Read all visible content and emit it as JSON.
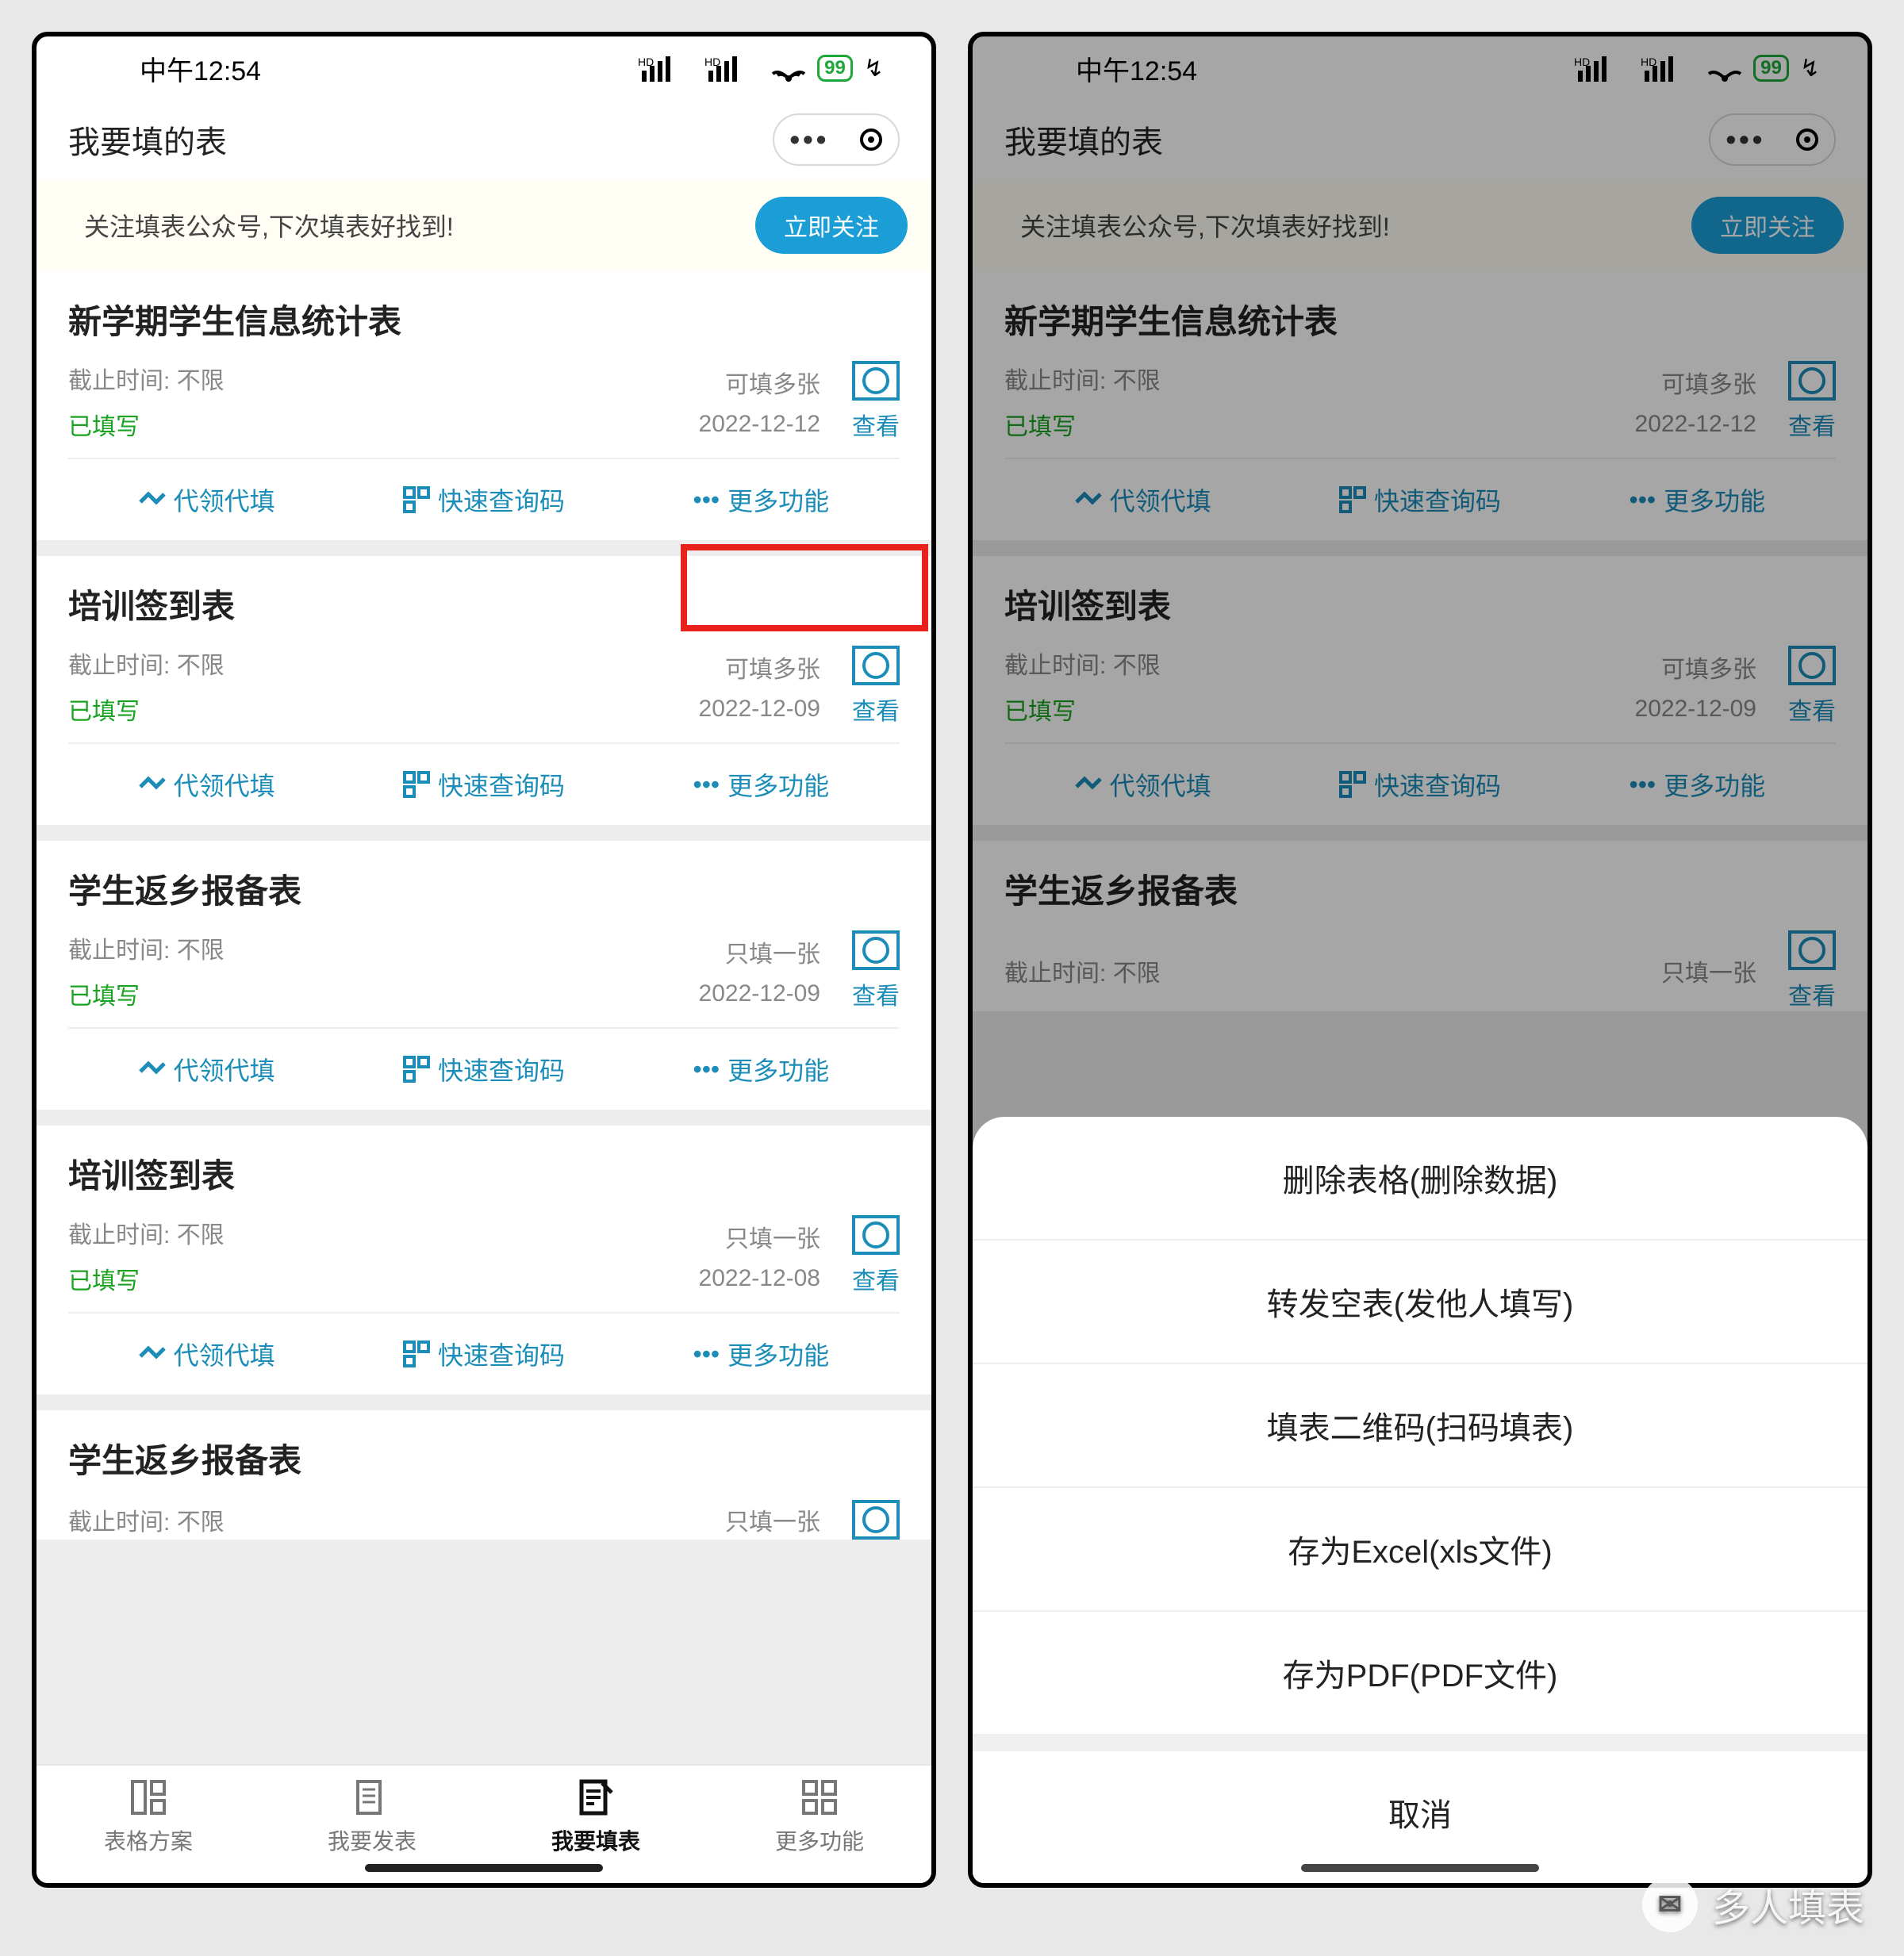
{
  "status": {
    "time": "中午12:54",
    "battery": "99"
  },
  "header": {
    "title": "我要填的表",
    "menu_dots": "•••"
  },
  "banner": {
    "text": "关注填表公众号,下次填表好找到!",
    "button": "立即关注"
  },
  "common": {
    "deadline_prefix": "截止时间:",
    "view": "查看",
    "act_proxy": "代领代填",
    "act_query": "快速查询码",
    "act_more": "更多功能",
    "act_more_dots": "•••"
  },
  "forms": [
    {
      "title": "新学期学生信息统计表",
      "deadline": "不限",
      "status": "已填写",
      "limit": "可填多张",
      "date": "2022-12-12"
    },
    {
      "title": "培训签到表",
      "deadline": "不限",
      "status": "已填写",
      "limit": "可填多张",
      "date": "2022-12-09"
    },
    {
      "title": "学生返乡报备表",
      "deadline": "不限",
      "status": "已填写",
      "limit": "只填一张",
      "date": "2022-12-09"
    },
    {
      "title": "培训签到表",
      "deadline": "不限",
      "status": "已填写",
      "limit": "只填一张",
      "date": "2022-12-08"
    },
    {
      "title": "学生返乡报备表",
      "deadline": "不限",
      "status": "",
      "limit": "只填一张",
      "date": ""
    }
  ],
  "nav": {
    "items": [
      {
        "label": "表格方案"
      },
      {
        "label": "我要发表"
      },
      {
        "label": "我要填表"
      },
      {
        "label": "更多功能"
      }
    ]
  },
  "sheet": {
    "items": [
      "删除表格(删除数据)",
      "转发空表(发他人填写)",
      "填表二维码(扫码填表)",
      "存为Excel(xls文件)",
      "存为PDF(PDF文件)"
    ],
    "cancel": "取消"
  },
  "watermark": {
    "text": "多人填表"
  }
}
